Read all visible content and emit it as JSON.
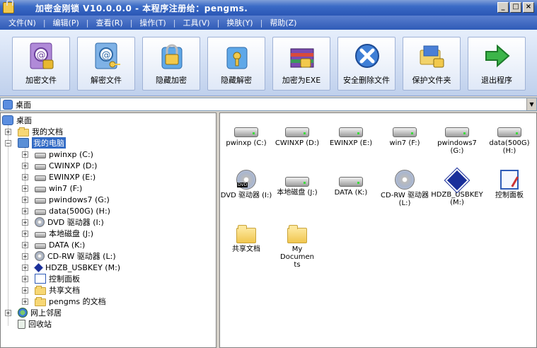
{
  "window": {
    "title": "加密金刚锁 V10.0.0.0 - 本程序注册给：pengms."
  },
  "menu": [
    "文件(N)",
    "编辑(P)",
    "查看(R)",
    "操作(T)",
    "工具(V)",
    "换肤(Y)",
    "帮助(Z)"
  ],
  "toolbar": [
    {
      "label": "加密文件",
      "icon": "encrypt-file-icon"
    },
    {
      "label": "解密文件",
      "icon": "decrypt-file-icon"
    },
    {
      "label": "隐藏加密",
      "icon": "hide-encrypt-icon"
    },
    {
      "label": "隐藏解密",
      "icon": "hide-decrypt-icon"
    },
    {
      "label": "加密为EXE",
      "icon": "encrypt-exe-icon"
    },
    {
      "label": "安全删除文件",
      "icon": "secure-delete-icon"
    },
    {
      "label": "保护文件夹",
      "icon": "protect-folder-icon"
    },
    {
      "label": "退出程序",
      "icon": "exit-icon"
    }
  ],
  "address": {
    "value": "桌面"
  },
  "tree": {
    "root": "桌面",
    "my_docs": "我的文档",
    "my_computer": "我的电脑",
    "drives": [
      {
        "label": "pwinxp  (C:)",
        "icon": "drive"
      },
      {
        "label": "CWINXP  (D:)",
        "icon": "drive"
      },
      {
        "label": "EWINXP  (E:)",
        "icon": "drive"
      },
      {
        "label": "win7  (F:)",
        "icon": "drive"
      },
      {
        "label": "pwindows7  (G:)",
        "icon": "drive"
      },
      {
        "label": "data(500G)  (H:)",
        "icon": "drive"
      },
      {
        "label": "DVD 驱动器  (I:)",
        "icon": "cd"
      },
      {
        "label": "本地磁盘  (J:)",
        "icon": "drive"
      },
      {
        "label": "DATA  (K:)",
        "icon": "drive"
      },
      {
        "label": "CD-RW 驱动器  (L:)",
        "icon": "cd"
      },
      {
        "label": "HDZB_USBKEY  (M:)",
        "icon": "usb"
      },
      {
        "label": "控制面板",
        "icon": "control-panel"
      },
      {
        "label": "共享文档",
        "icon": "folder"
      },
      {
        "label": "pengms 的文档",
        "icon": "folder"
      }
    ],
    "network": "网上邻居",
    "recycle": "回收站"
  },
  "files": [
    {
      "label": "pwinxp (C:)",
      "icon": "drive"
    },
    {
      "label": "CWINXP (D:)",
      "icon": "drive"
    },
    {
      "label": "EWINXP (E:)",
      "icon": "drive"
    },
    {
      "label": "win7 (F:)",
      "icon": "drive"
    },
    {
      "label": "pwindows7 (G:)",
      "icon": "drive"
    },
    {
      "label": "data(500G) (H:)",
      "icon": "drive"
    },
    {
      "label": "DVD 驱动器 (I:)",
      "icon": "dvd"
    },
    {
      "label": "本地磁盘 (J:)",
      "icon": "drive"
    },
    {
      "label": "DATA (K:)",
      "icon": "drive"
    },
    {
      "label": "CD-RW 驱动器 (L:)",
      "icon": "cd"
    },
    {
      "label": "HDZB_USBKEY (M:)",
      "icon": "usb"
    },
    {
      "label": "控制面板",
      "icon": "control-panel"
    },
    {
      "label": "共享文档",
      "icon": "folder"
    },
    {
      "label": "My Documents",
      "icon": "folder"
    }
  ]
}
